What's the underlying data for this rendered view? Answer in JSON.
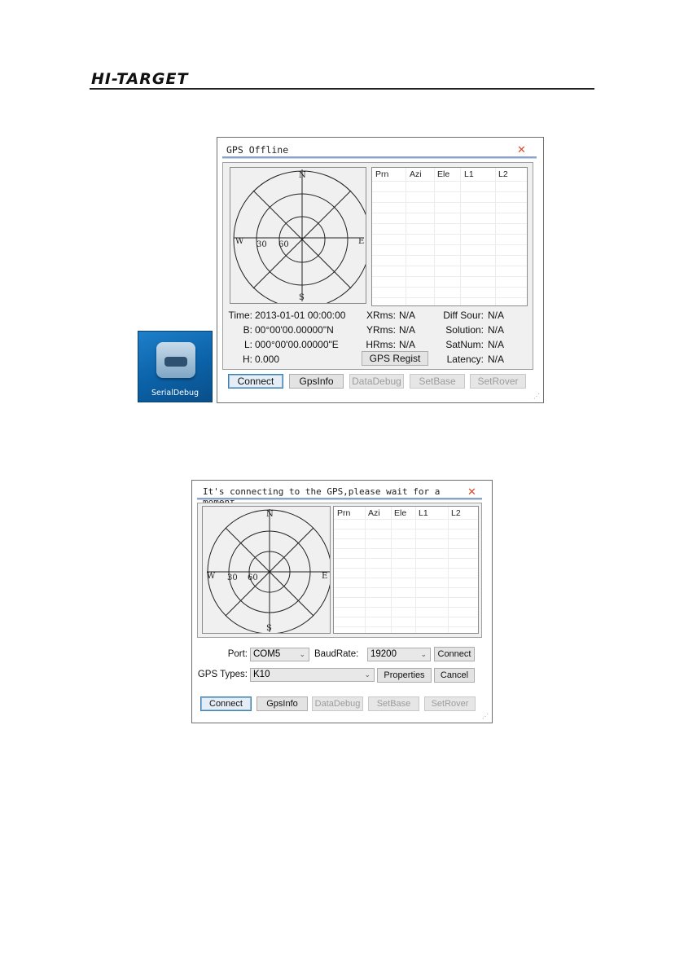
{
  "header": {
    "logo_text": "HI-TARGET"
  },
  "app_icon": {
    "label": "SerialDebug",
    "icon": "serial-port-connector-icon"
  },
  "dialog1": {
    "title": "GPS Offline",
    "skyplot": {
      "north": "N",
      "south": "S",
      "east": "E",
      "west": "W",
      "ring1": "30",
      "ring2": "60"
    },
    "table_headers": [
      "Prn",
      "Azi",
      "Ele",
      "L1",
      "L2"
    ],
    "info": {
      "time_label": "Time:",
      "time_value": "2013-01-01 00:00:00",
      "b_label": "B:",
      "b_value": "00°00'00.00000\"N",
      "l_label": "L:",
      "l_value": "000°00'00.00000\"E",
      "h_label": "H:",
      "h_value": "0.000",
      "xrms_label": "XRms:",
      "xrms_value": "N/A",
      "yrms_label": "YRms:",
      "yrms_value": "N/A",
      "hrms_label": "HRms:",
      "hrms_value": "N/A",
      "diff_label": "Diff Sour:",
      "diff_value": "N/A",
      "solution_label": "Solution:",
      "solution_value": "N/A",
      "satnum_label": "SatNum:",
      "satnum_value": "N/A",
      "latency_label": "Latency:",
      "latency_value": "N/A"
    },
    "gps_regist_button": "GPS Regist",
    "buttons": {
      "connect": "Connect",
      "gpsinfo": "GpsInfo",
      "datadebug": "DataDebug",
      "setbase": "SetBase",
      "setrover": "SetRover"
    }
  },
  "dialog2": {
    "title": "It's connecting to the GPS,please wait for a moment...",
    "skyplot": {
      "north": "N",
      "south": "S",
      "east": "E",
      "west": "W",
      "ring1": "30",
      "ring2": "60"
    },
    "table_headers": [
      "Prn",
      "Azi",
      "Ele",
      "L1",
      "L2"
    ],
    "port_label": "Port:",
    "port_value": "COM5",
    "baud_label": "BaudRate:",
    "baud_value": "19200",
    "connect_small": "Connect",
    "gpstypes_label": "GPS Types:",
    "gpstypes_value": "K10",
    "properties_button": "Properties",
    "cancel_button": "Cancel",
    "buttons": {
      "connect": "Connect",
      "gpsinfo": "GpsInfo",
      "datadebug": "DataDebug",
      "setbase": "SetBase",
      "setrover": "SetRover"
    }
  }
}
